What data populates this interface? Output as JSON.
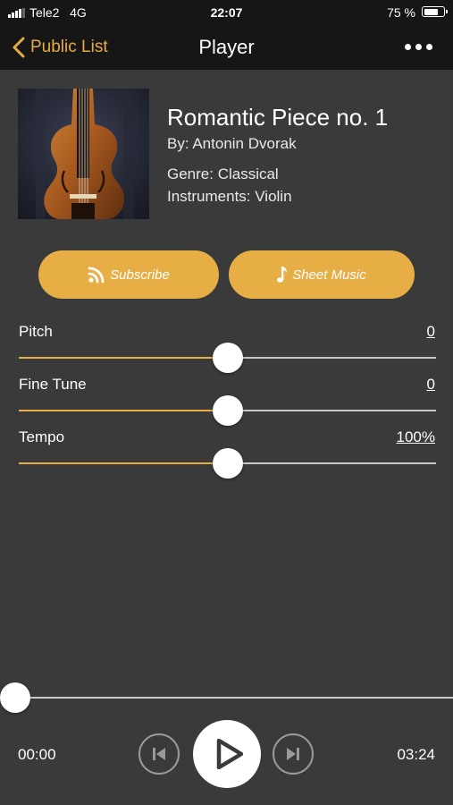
{
  "status_bar": {
    "carrier": "Tele2",
    "network": "4G",
    "time": "22:07",
    "battery": "75 %",
    "battery_level": 0.75
  },
  "nav": {
    "back_label": "Public List",
    "title": "Player",
    "more_icon": "ellipsis-icon"
  },
  "track": {
    "title": "Romantic Piece no. 1",
    "composer": "By: Antonin Dvorak",
    "genre": "Genre: Classical",
    "instruments": "Instruments: Violin"
  },
  "actions": {
    "subscribe_label": "Subscribe",
    "sheet_music_label": "Sheet Music"
  },
  "sliders": [
    {
      "label": "Pitch",
      "value": "0",
      "level": 0.5
    },
    {
      "label": "Fine Tune",
      "value": "0",
      "level": 0.5
    },
    {
      "label": "Tempo",
      "value": "100%",
      "level": 0.5
    }
  ],
  "playback": {
    "elapsed": "00:00",
    "total": "03:24",
    "progress": 0
  },
  "colors": {
    "accent": "#e7ae45",
    "background": "#3a3a3a",
    "bars": "#161616"
  }
}
